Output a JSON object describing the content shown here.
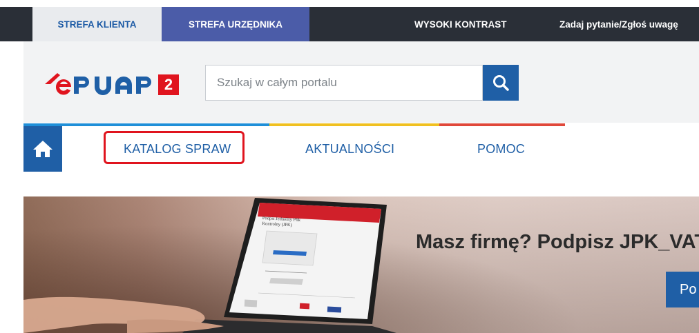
{
  "topbar": {
    "tab_klienta": "STREFA KLIENTA",
    "tab_urzednika": "STREFA URZĘDNIKA",
    "wysoki_kontrast": "WYSOKI KONTRAST",
    "zadaj_pytanie": "Zadaj pytanie/Zgłoś uwagę"
  },
  "header": {
    "logo_text": "ePUAP",
    "logo_badge": "2",
    "search": {
      "placeholder": "Szukaj w całym portalu",
      "value": "",
      "button_icon": "search-icon"
    }
  },
  "nav": {
    "home_icon": "home-icon",
    "items": [
      {
        "label": "KATALOG SPRAW",
        "highlighted": true
      },
      {
        "label": "AKTUALNOŚCI"
      },
      {
        "label": "POMOC"
      }
    ]
  },
  "banner": {
    "title": "Masz firmę? Podpisz JPK_VAT",
    "button_label": "Po",
    "laptop_screen": {
      "heading": "Podpis Jednolity Plik Kontrolny (JPK)"
    }
  },
  "colors": {
    "primary_blue": "#1f5fa6",
    "topbar_dark": "#2a2f37",
    "tab_purple": "#4b5ca8",
    "logo_red": "#e0141e",
    "highlight_red": "#e0141e",
    "strip_blue": "#1f8fd8",
    "strip_yellow": "#f0c020",
    "strip_red": "#e0483a"
  }
}
